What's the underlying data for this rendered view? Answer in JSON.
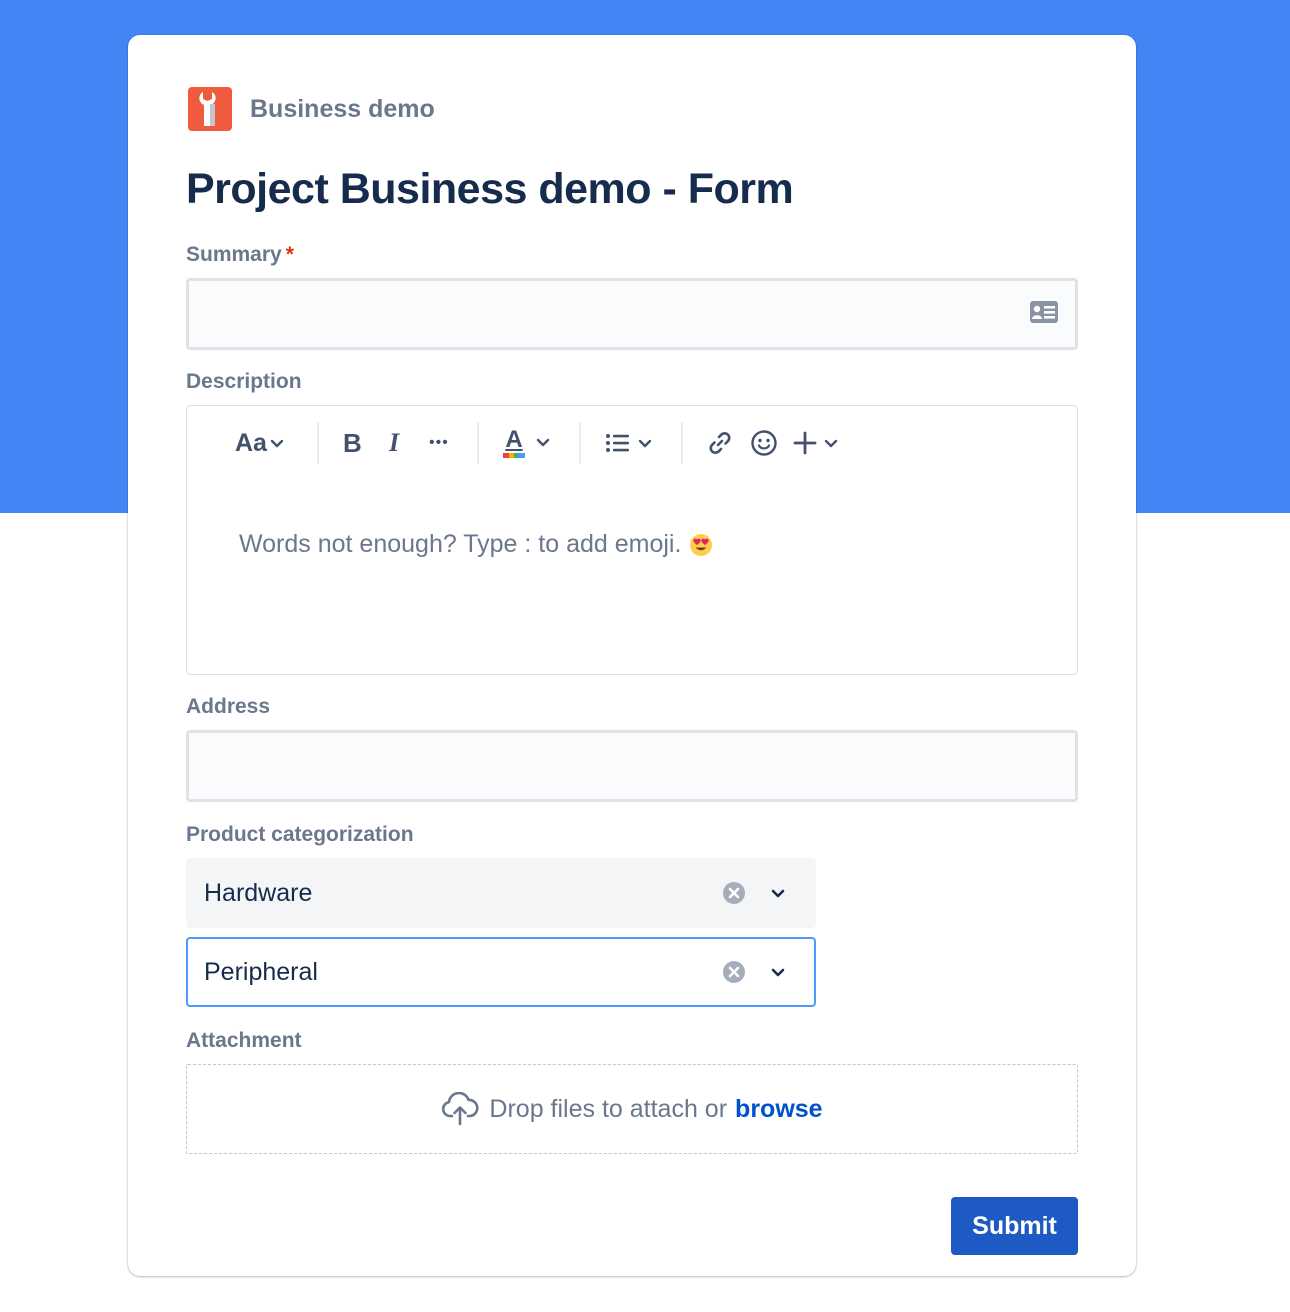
{
  "project": {
    "name": "Business demo",
    "icon": "wrench-icon",
    "avatar_color": "#f05a3f"
  },
  "form": {
    "title": "Project Business demo - Form"
  },
  "fields": {
    "summary": {
      "label": "Summary",
      "required_mark": "*",
      "value": ""
    },
    "description": {
      "label": "Description",
      "toolbar": {
        "text_style": "Aa",
        "bold": "B",
        "italic": "I",
        "more": "•••",
        "text_color": "A"
      },
      "placeholder": "Words not enough? Type : to add emoji.",
      "placeholder_emoji": "😍"
    },
    "address": {
      "label": "Address",
      "value": ""
    },
    "product_categorization": {
      "label": "Product categorization",
      "level1": "Hardware",
      "level2": "Peripheral"
    },
    "attachment": {
      "label": "Attachment",
      "drop_text": "Drop files to attach or",
      "browse_text": "browse"
    }
  },
  "actions": {
    "submit": "Submit"
  },
  "colors": {
    "band": "#4285f4",
    "primary": "#1e5ac4",
    "link": "#0052cc",
    "focus": "#4c9aff",
    "required": "#de350b"
  }
}
